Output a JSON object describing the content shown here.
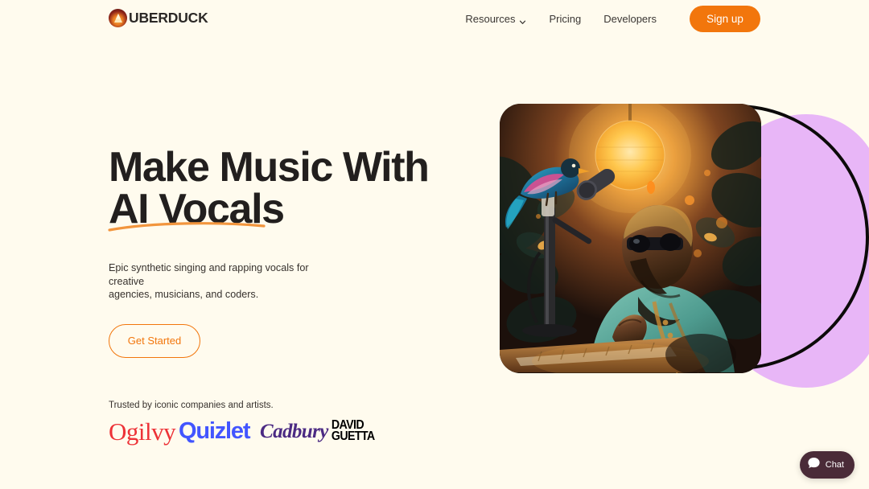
{
  "brand": {
    "name": "UBERDUCK",
    "accent_color": "#F2760C",
    "background_color": "#FFFBEE",
    "text_color": "#221F1E",
    "blob_color": "#E8B6F7"
  },
  "header": {
    "nav": [
      {
        "label": "Resources",
        "has_dropdown": true,
        "icon": "chevron-down-icon"
      },
      {
        "label": "Pricing",
        "has_dropdown": false
      },
      {
        "label": "Developers",
        "has_dropdown": false
      }
    ],
    "signup_label": "Sign up"
  },
  "hero": {
    "headline": "Make Music With\nAI Vocals",
    "headline_line1": "Make Music With",
    "headline_line2": "AI Vocals",
    "subhead": "Epic synthetic singing and rapping vocals for creative\nagencies, musicians, and coders.",
    "cta_label": "Get Started",
    "image_alt": "Singer with sunglasses at a microphone beside a colorful perched bird, warm glowing lantern background"
  },
  "trusted": {
    "label": "Trusted by iconic companies and artists.",
    "brands": [
      {
        "name": "Ogilvy",
        "text": "Ogilvy",
        "color": "#ED3237"
      },
      {
        "name": "Quizlet",
        "text": "Quizlet",
        "color": "#4255FF"
      },
      {
        "name": "Cadbury",
        "text": "Cadbury",
        "color": "#4B2A83"
      },
      {
        "name": "David Guetta",
        "text_line1": "DAVID",
        "text_line2": "GUETTA",
        "color": "#000000"
      }
    ]
  },
  "chat_widget": {
    "label": "Chat",
    "icon": "chat-bubble-icon",
    "background_color": "#4A2B38"
  }
}
